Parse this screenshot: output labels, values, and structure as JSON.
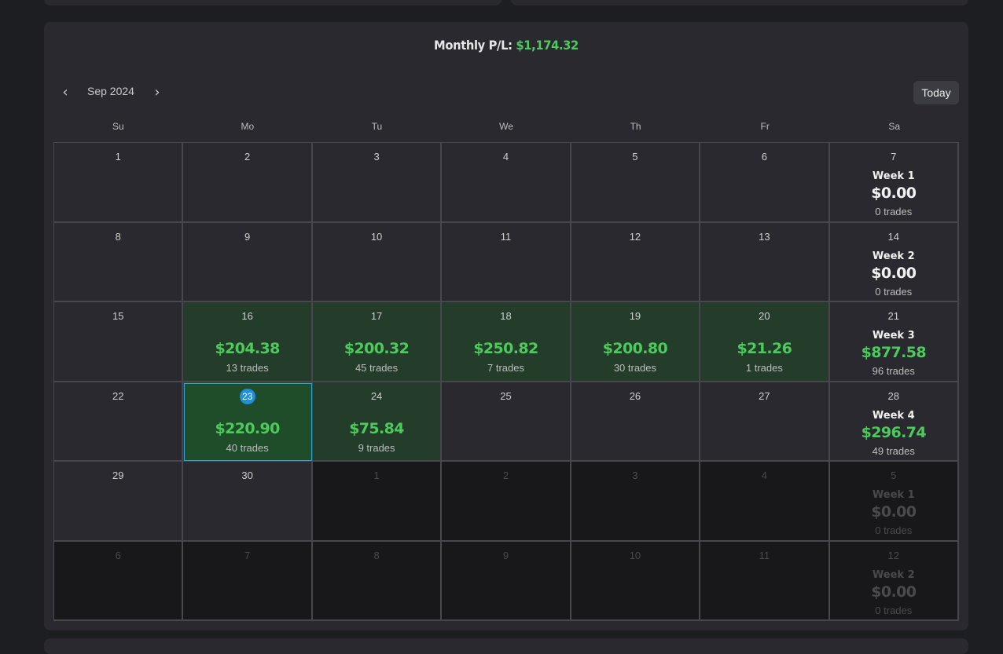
{
  "header": {
    "monthly_label": "Monthly P/L:",
    "monthly_value": "$1,174.32"
  },
  "nav": {
    "month": "Sep 2024",
    "prev_icon": "chevron-left-icon",
    "next_icon": "chevron-right-icon",
    "prev_glyph": "‹",
    "next_glyph": "›",
    "today_label": "Today"
  },
  "weekdays": [
    "Su",
    "Mo",
    "Tu",
    "We",
    "Th",
    "Fr",
    "Sa"
  ],
  "colors": {
    "panel": "#2a292f",
    "background": "#1d1e22",
    "profit_cell": "#243d2a",
    "positive_text": "#4ccb5c",
    "today_badge": "#1f8fd6",
    "outside_month": "#18181a"
  },
  "weeks": [
    {
      "days": [
        {
          "date": "1"
        },
        {
          "date": "2"
        },
        {
          "date": "3"
        },
        {
          "date": "4"
        },
        {
          "date": "5"
        },
        {
          "date": "6"
        },
        {
          "date": "7",
          "week": {
            "label": "Week 1",
            "pnl": "$0.00",
            "trades": "0 trades"
          }
        }
      ]
    },
    {
      "days": [
        {
          "date": "8"
        },
        {
          "date": "9"
        },
        {
          "date": "10"
        },
        {
          "date": "11"
        },
        {
          "date": "12"
        },
        {
          "date": "13"
        },
        {
          "date": "14",
          "week": {
            "label": "Week 2",
            "pnl": "$0.00",
            "trades": "0 trades"
          }
        }
      ]
    },
    {
      "days": [
        {
          "date": "15"
        },
        {
          "date": "16",
          "pnl": "$204.38",
          "trades": "13 trades"
        },
        {
          "date": "17",
          "pnl": "$200.32",
          "trades": "45 trades"
        },
        {
          "date": "18",
          "pnl": "$250.82",
          "trades": "7 trades"
        },
        {
          "date": "19",
          "pnl": "$200.80",
          "trades": "30 trades"
        },
        {
          "date": "20",
          "pnl": "$21.26",
          "trades": "1 trades"
        },
        {
          "date": "21",
          "week": {
            "label": "Week 3",
            "pnl": "$877.58",
            "trades": "96 trades",
            "positive": true
          }
        }
      ]
    },
    {
      "days": [
        {
          "date": "22"
        },
        {
          "date": "23",
          "pnl": "$220.90",
          "trades": "40 trades",
          "today": true
        },
        {
          "date": "24",
          "pnl": "$75.84",
          "trades": "9 trades"
        },
        {
          "date": "25"
        },
        {
          "date": "26"
        },
        {
          "date": "27"
        },
        {
          "date": "28",
          "week": {
            "label": "Week 4",
            "pnl": "$296.74",
            "trades": "49 trades",
            "positive": true
          }
        }
      ]
    },
    {
      "days": [
        {
          "date": "29"
        },
        {
          "date": "30"
        },
        {
          "date": "1",
          "out": true
        },
        {
          "date": "2",
          "out": true
        },
        {
          "date": "3",
          "out": true
        },
        {
          "date": "4",
          "out": true
        },
        {
          "date": "5",
          "out": true,
          "week": {
            "label": "Week 1",
            "pnl": "$0.00",
            "trades": "0 trades"
          }
        }
      ]
    },
    {
      "days": [
        {
          "date": "6",
          "out": true
        },
        {
          "date": "7",
          "out": true
        },
        {
          "date": "8",
          "out": true
        },
        {
          "date": "9",
          "out": true
        },
        {
          "date": "10",
          "out": true
        },
        {
          "date": "11",
          "out": true
        },
        {
          "date": "12",
          "out": true,
          "week": {
            "label": "Week 2",
            "pnl": "$0.00",
            "trades": "0 trades"
          }
        }
      ]
    }
  ]
}
